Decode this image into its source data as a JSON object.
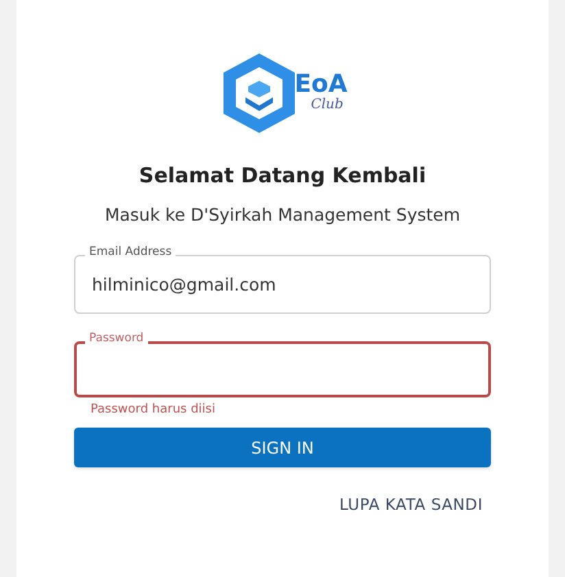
{
  "logo": {
    "text": "EoA",
    "subtext": "Club"
  },
  "title": "Selamat Datang Kembali",
  "subtitle": "Masuk ke D'Syirkah Management System",
  "fields": [
    {
      "label": "Email Address",
      "value": "hilminico@gmail.com",
      "error": false
    },
    {
      "label": "Password",
      "error": true,
      "helper": "Password harus diisi"
    }
  ],
  "sign_in_button": "SIGN IN",
  "forgot_link": "LUPA KATA SANDI"
}
